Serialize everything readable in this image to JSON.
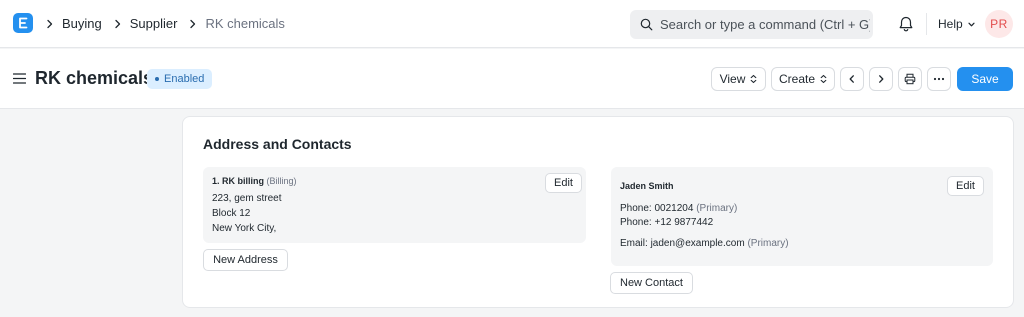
{
  "navbar": {
    "breadcrumbs": [
      "Buying",
      "Supplier",
      "RK chemicals"
    ],
    "search_placeholder": "Search or type a command (Ctrl + G)",
    "help_label": "Help",
    "avatar_initials": "PR"
  },
  "page": {
    "title": "RK chemicals",
    "status_badge": "Enabled",
    "actions": {
      "view": "View",
      "create": "Create",
      "save": "Save"
    }
  },
  "section": {
    "title": "Address and Contacts",
    "address": {
      "name": "1. RK billing",
      "type": "(Billing)",
      "lines": [
        "223, gem street",
        "Block 12",
        "New York City,"
      ],
      "edit_label": "Edit",
      "new_label": "New Address"
    },
    "contact": {
      "name": "Jaden Smith",
      "phones": [
        {
          "label": "Phone:",
          "value": "0021204",
          "tag": "(Primary)"
        },
        {
          "label": "Phone:",
          "value": "+12 9877442",
          "tag": ""
        }
      ],
      "email": {
        "label": "Email:",
        "value": "jaden@example.com",
        "tag": "(Primary)"
      },
      "edit_label": "Edit",
      "new_label": "New Contact"
    }
  },
  "colors": {
    "primary": "#2490ef",
    "badge_bg": "#dbeeff",
    "avatar_bg": "#fde8e8",
    "avatar_text": "#e24c4c"
  }
}
